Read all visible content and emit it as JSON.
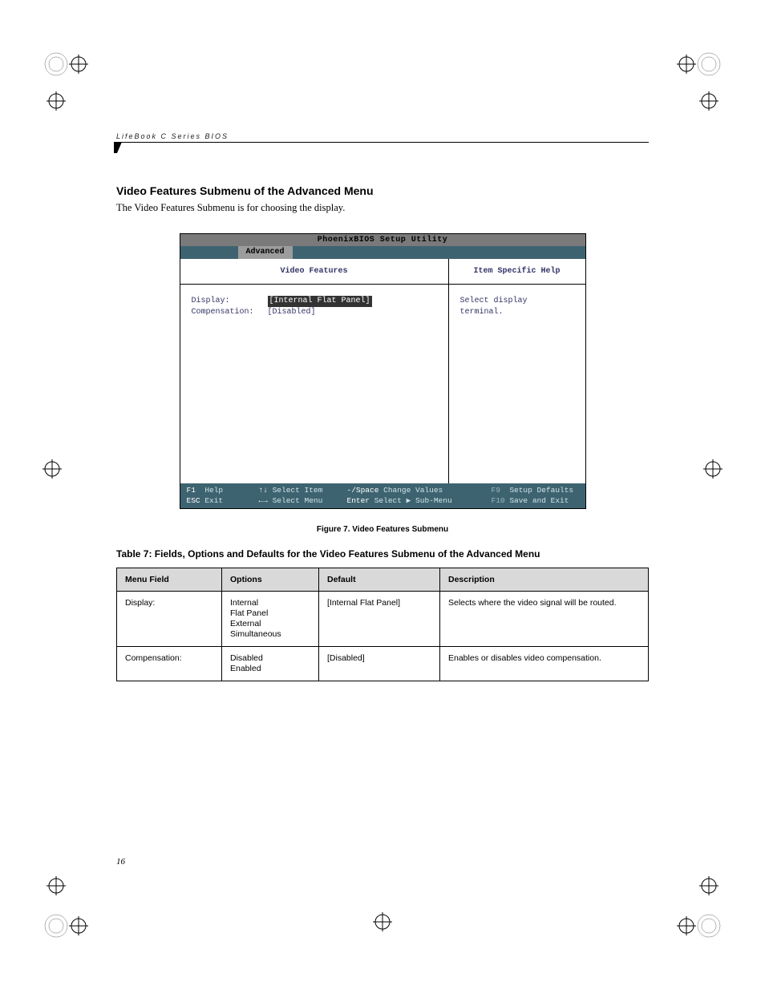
{
  "header": {
    "running": "LifeBook C Series BIOS"
  },
  "section": {
    "title": "Video Features Submenu of the Advanced Menu",
    "intro": "The Video Features Submenu is for choosing the display."
  },
  "bios": {
    "title": "PhoenixBIOS Setup Utility",
    "active_tab": "Advanced",
    "left_header": "Video Features",
    "right_header": "Item Specific Help",
    "fields": {
      "display_label": "Display:",
      "display_value": "[Internal Flat Panel]",
      "comp_label": "Compensation:",
      "comp_value": "[Disabled]"
    },
    "help_text": "Select display terminal.",
    "footer": {
      "r1c1_key": "F1",
      "r1c1_txt": "Help",
      "r1c2_key": "↑↓",
      "r1c2_txt": "Select Item",
      "r1c3_key": "-/Space",
      "r1c3_txt": "Change Values",
      "r1c4_key": "F9",
      "r1c4_txt": "Setup Defaults",
      "r2c1_key": "ESC",
      "r2c1_txt": "Exit",
      "r2c2_key": "←→",
      "r2c2_txt": "Select Menu",
      "r2c3_key": "Enter",
      "r2c3_txt": "Select ▶ Sub-Menu",
      "r2c4_key": "F10",
      "r2c4_txt": "Save and Exit"
    }
  },
  "figure_caption": "Figure 7.  Video Features Submenu",
  "table_caption": "Table 7: Fields, Options and Defaults for the Video Features Submenu of the Advanced Menu",
  "table": {
    "headers": [
      "Menu Field",
      "Options",
      "Default",
      "Description"
    ],
    "rows": [
      {
        "field": "Display:",
        "options": [
          "Internal",
          "Flat Panel",
          "External",
          "Simultaneous"
        ],
        "default": "[Internal Flat Panel]",
        "description": "Selects where the video signal will be routed."
      },
      {
        "field": "Compensation:",
        "options": [
          "Disabled",
          "Enabled"
        ],
        "default": "[Disabled]",
        "description": "Enables or disables video compensation."
      }
    ]
  },
  "page_number": "16"
}
